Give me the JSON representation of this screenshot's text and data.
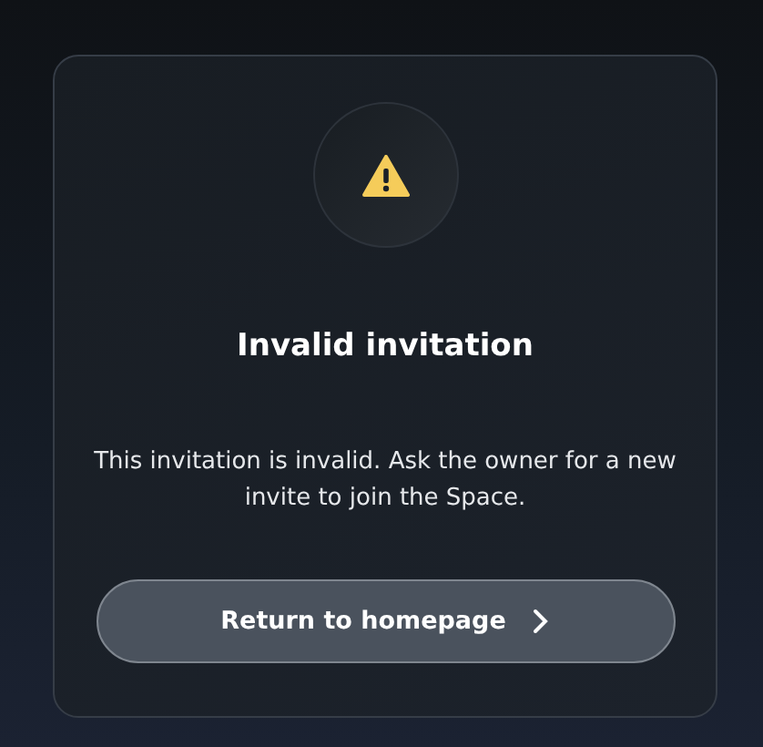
{
  "dialog": {
    "title": "Invalid invitation",
    "message": "This invitation is invalid. Ask the owner for a new invite to join the Space.",
    "button": {
      "label": "Return to homepage"
    }
  }
}
